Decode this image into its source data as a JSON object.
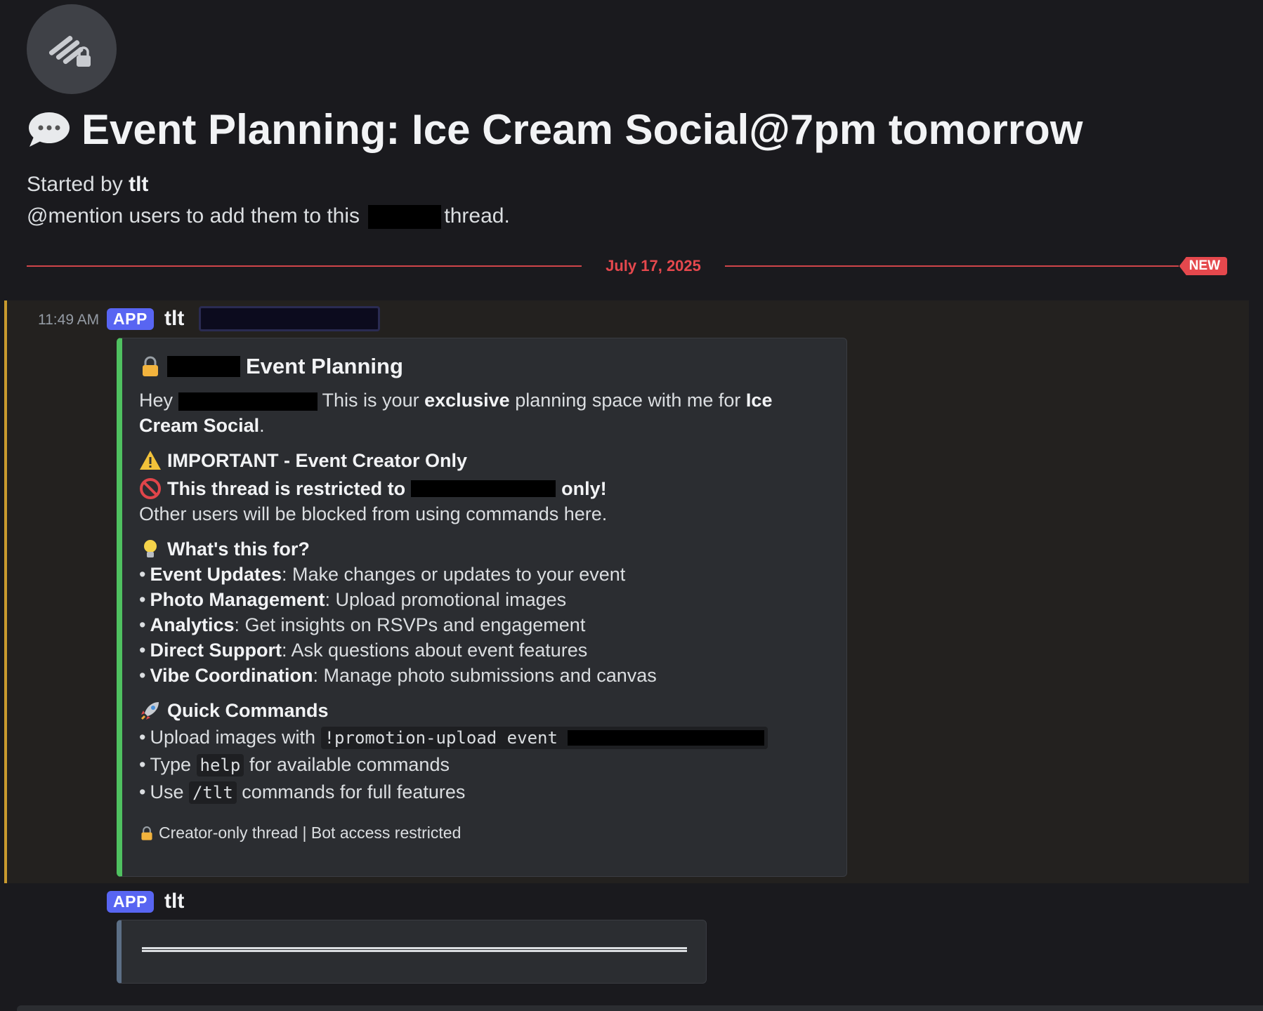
{
  "thread": {
    "title": "Event Planning: Ice Cream Social@7pm tomorrow",
    "started_by_prefix": "Started by",
    "started_by_user": "tlt",
    "mention_hint_prefix": "@mention users to add them to this",
    "mention_hint_suffix": "thread."
  },
  "divider": {
    "date": "July 17, 2025",
    "new_badge": "NEW"
  },
  "message1": {
    "timestamp": "11:49 AM",
    "app_badge": "APP",
    "author": "tlt",
    "embed": {
      "title": "Event Planning",
      "intro_hey": "Hey",
      "intro_a": "This is your",
      "intro_exclusive": "exclusive",
      "intro_b": "planning space with me for",
      "intro_event": "Ice Cream Social",
      "intro_end": ".",
      "important_heading": "IMPORTANT - Event Creator Only",
      "restricted_prefix": "This thread is restricted to",
      "restricted_suffix": "only!",
      "blocked_line": "Other users will be blocked from using commands here.",
      "whats_for_heading": "What's this for?",
      "features": [
        {
          "name": "Event Updates",
          "desc": ": Make changes or updates to your event"
        },
        {
          "name": "Photo Management",
          "desc": ": Upload promotional images"
        },
        {
          "name": "Analytics",
          "desc": ": Get insights on RSVPs and engagement"
        },
        {
          "name": "Direct Support",
          "desc": ": Ask questions about event features"
        },
        {
          "name": "Vibe Coordination",
          "desc": ": Manage photo submissions and canvas"
        }
      ],
      "quick_heading": "Quick Commands",
      "cmd1_prefix": "Upload images with",
      "cmd1_code": "!promotion-upload event",
      "cmd2_prefix": "Type",
      "cmd2_code": "help",
      "cmd2_suffix": "for available commands",
      "cmd3_prefix": "Use",
      "cmd3_code": "/tlt",
      "cmd3_suffix": "commands for full features",
      "footer": "Creator-only thread | Bot access restricted"
    }
  },
  "message2": {
    "app_badge": "APP",
    "author": "tlt"
  },
  "colors": {
    "accent_new": "#e5484d",
    "app_badge": "#5865f2",
    "embed_bar": "#4fc160",
    "highlight_bar": "#c99a2e"
  }
}
